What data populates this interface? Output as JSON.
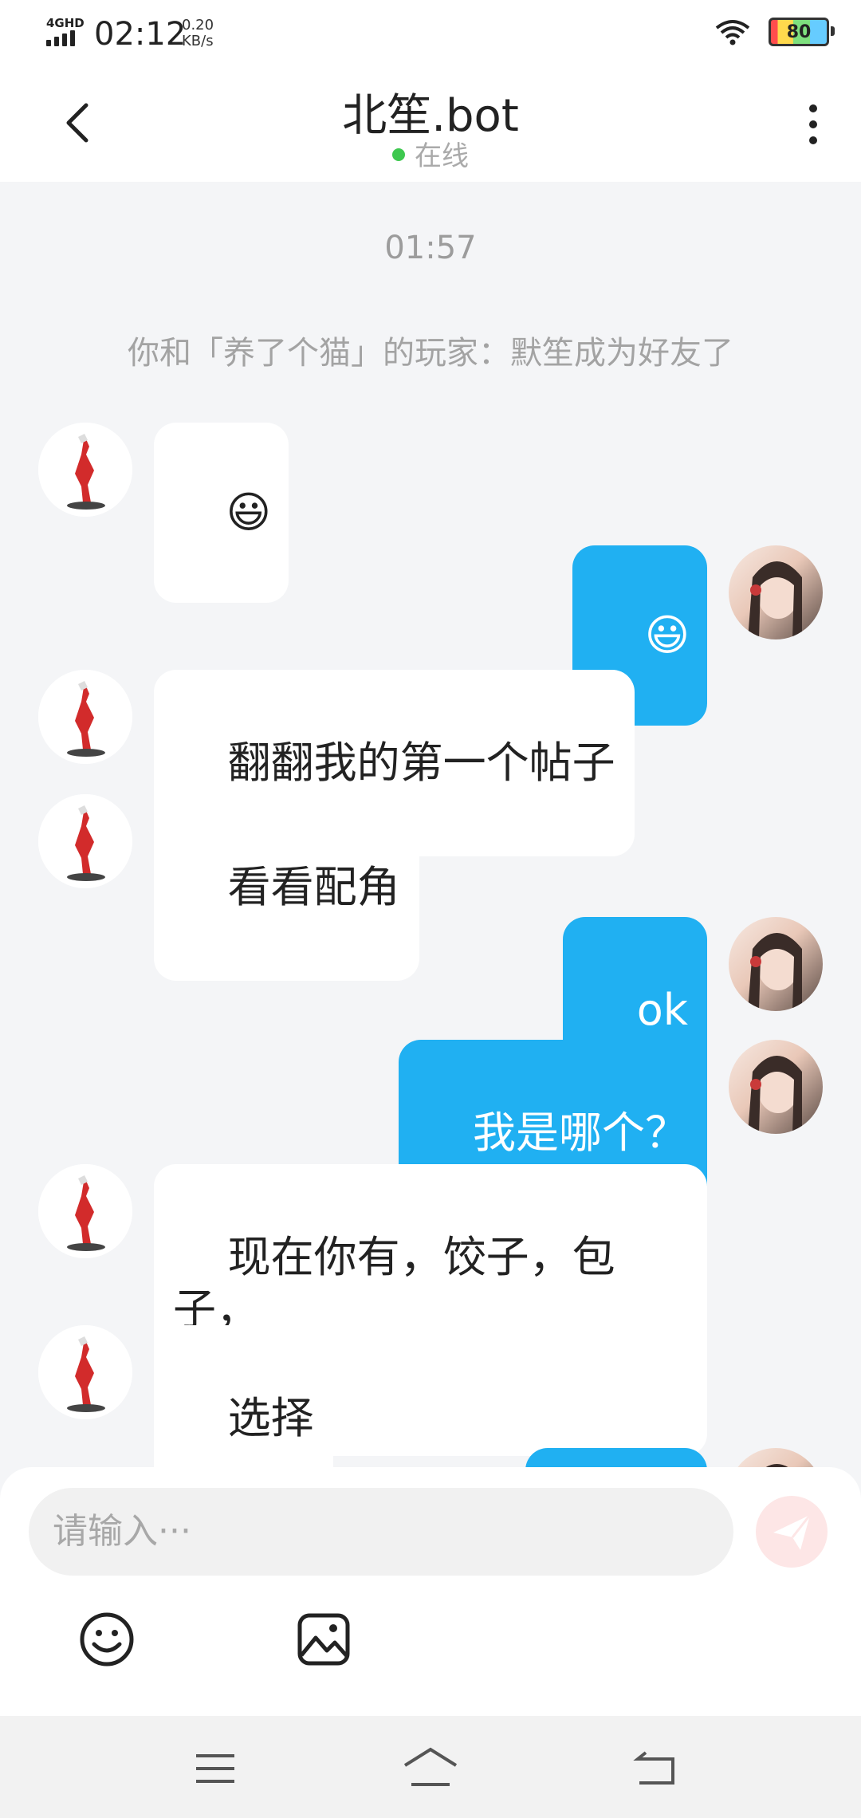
{
  "status_bar": {
    "network": "4GHD",
    "time": "02:12",
    "speed_value": "0.20",
    "speed_unit": "KB/s",
    "battery": "80"
  },
  "header": {
    "title": "北笙.bot",
    "status": "在线",
    "status_color": "#3ec84f"
  },
  "chat": {
    "timestamp": "01:57",
    "system_notice": "你和「养了个猫」的玩家：默笙成为好友了",
    "messages": [
      {
        "from": "bot",
        "text": "😃"
      },
      {
        "from": "me",
        "text": "😃"
      },
      {
        "from": "bot",
        "text": "翻翻我的第一个帖子"
      },
      {
        "from": "bot",
        "text": "看看配角"
      },
      {
        "from": "me",
        "text": "ok"
      },
      {
        "from": "me",
        "text": "我是哪个？"
      },
      {
        "from": "bot",
        "text": "现在你有，饺子，包子，\n许诚"
      },
      {
        "from": "bot",
        "text": "选择"
      }
    ]
  },
  "input": {
    "placeholder": "请输入···"
  },
  "icons": {
    "back": "chevron-left-icon",
    "more": "more-vertical-icon",
    "send": "send-icon",
    "emoji": "emoji-icon",
    "image": "image-icon",
    "nav_menu": "menu-icon",
    "nav_home": "home-icon",
    "nav_back": "back-icon"
  },
  "colors": {
    "bubble_out": "#20b0f2",
    "bubble_in": "#ffffff",
    "background": "#f4f5f7"
  }
}
